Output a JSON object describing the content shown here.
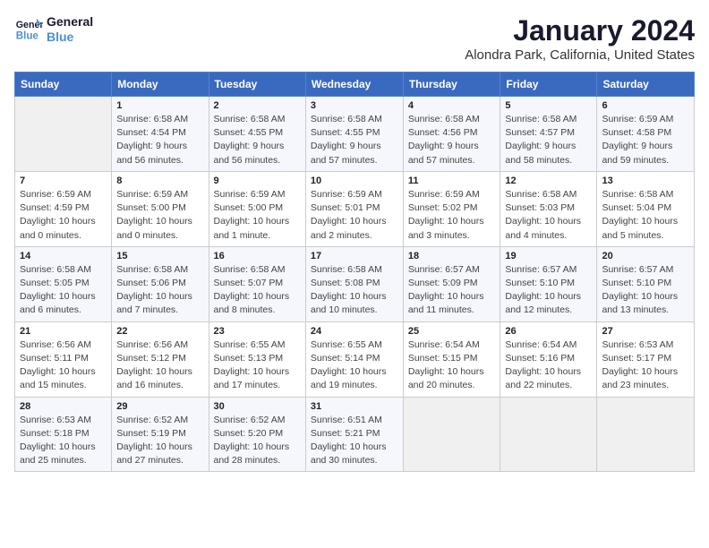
{
  "header": {
    "logo_line1": "General",
    "logo_line2": "Blue",
    "month": "January 2024",
    "location": "Alondra Park, California, United States"
  },
  "weekdays": [
    "Sunday",
    "Monday",
    "Tuesday",
    "Wednesday",
    "Thursday",
    "Friday",
    "Saturday"
  ],
  "weeks": [
    [
      {
        "day": "",
        "sunrise": "",
        "sunset": "",
        "daylight": ""
      },
      {
        "day": "1",
        "sunrise": "Sunrise: 6:58 AM",
        "sunset": "Sunset: 4:54 PM",
        "daylight": "Daylight: 9 hours and 56 minutes."
      },
      {
        "day": "2",
        "sunrise": "Sunrise: 6:58 AM",
        "sunset": "Sunset: 4:55 PM",
        "daylight": "Daylight: 9 hours and 56 minutes."
      },
      {
        "day": "3",
        "sunrise": "Sunrise: 6:58 AM",
        "sunset": "Sunset: 4:55 PM",
        "daylight": "Daylight: 9 hours and 57 minutes."
      },
      {
        "day": "4",
        "sunrise": "Sunrise: 6:58 AM",
        "sunset": "Sunset: 4:56 PM",
        "daylight": "Daylight: 9 hours and 57 minutes."
      },
      {
        "day": "5",
        "sunrise": "Sunrise: 6:58 AM",
        "sunset": "Sunset: 4:57 PM",
        "daylight": "Daylight: 9 hours and 58 minutes."
      },
      {
        "day": "6",
        "sunrise": "Sunrise: 6:59 AM",
        "sunset": "Sunset: 4:58 PM",
        "daylight": "Daylight: 9 hours and 59 minutes."
      }
    ],
    [
      {
        "day": "7",
        "sunrise": "Sunrise: 6:59 AM",
        "sunset": "Sunset: 4:59 PM",
        "daylight": "Daylight: 10 hours and 0 minutes."
      },
      {
        "day": "8",
        "sunrise": "Sunrise: 6:59 AM",
        "sunset": "Sunset: 5:00 PM",
        "daylight": "Daylight: 10 hours and 0 minutes."
      },
      {
        "day": "9",
        "sunrise": "Sunrise: 6:59 AM",
        "sunset": "Sunset: 5:00 PM",
        "daylight": "Daylight: 10 hours and 1 minute."
      },
      {
        "day": "10",
        "sunrise": "Sunrise: 6:59 AM",
        "sunset": "Sunset: 5:01 PM",
        "daylight": "Daylight: 10 hours and 2 minutes."
      },
      {
        "day": "11",
        "sunrise": "Sunrise: 6:59 AM",
        "sunset": "Sunset: 5:02 PM",
        "daylight": "Daylight: 10 hours and 3 minutes."
      },
      {
        "day": "12",
        "sunrise": "Sunrise: 6:58 AM",
        "sunset": "Sunset: 5:03 PM",
        "daylight": "Daylight: 10 hours and 4 minutes."
      },
      {
        "day": "13",
        "sunrise": "Sunrise: 6:58 AM",
        "sunset": "Sunset: 5:04 PM",
        "daylight": "Daylight: 10 hours and 5 minutes."
      }
    ],
    [
      {
        "day": "14",
        "sunrise": "Sunrise: 6:58 AM",
        "sunset": "Sunset: 5:05 PM",
        "daylight": "Daylight: 10 hours and 6 minutes."
      },
      {
        "day": "15",
        "sunrise": "Sunrise: 6:58 AM",
        "sunset": "Sunset: 5:06 PM",
        "daylight": "Daylight: 10 hours and 7 minutes."
      },
      {
        "day": "16",
        "sunrise": "Sunrise: 6:58 AM",
        "sunset": "Sunset: 5:07 PM",
        "daylight": "Daylight: 10 hours and 8 minutes."
      },
      {
        "day": "17",
        "sunrise": "Sunrise: 6:58 AM",
        "sunset": "Sunset: 5:08 PM",
        "daylight": "Daylight: 10 hours and 10 minutes."
      },
      {
        "day": "18",
        "sunrise": "Sunrise: 6:57 AM",
        "sunset": "Sunset: 5:09 PM",
        "daylight": "Daylight: 10 hours and 11 minutes."
      },
      {
        "day": "19",
        "sunrise": "Sunrise: 6:57 AM",
        "sunset": "Sunset: 5:10 PM",
        "daylight": "Daylight: 10 hours and 12 minutes."
      },
      {
        "day": "20",
        "sunrise": "Sunrise: 6:57 AM",
        "sunset": "Sunset: 5:10 PM",
        "daylight": "Daylight: 10 hours and 13 minutes."
      }
    ],
    [
      {
        "day": "21",
        "sunrise": "Sunrise: 6:56 AM",
        "sunset": "Sunset: 5:11 PM",
        "daylight": "Daylight: 10 hours and 15 minutes."
      },
      {
        "day": "22",
        "sunrise": "Sunrise: 6:56 AM",
        "sunset": "Sunset: 5:12 PM",
        "daylight": "Daylight: 10 hours and 16 minutes."
      },
      {
        "day": "23",
        "sunrise": "Sunrise: 6:55 AM",
        "sunset": "Sunset: 5:13 PM",
        "daylight": "Daylight: 10 hours and 17 minutes."
      },
      {
        "day": "24",
        "sunrise": "Sunrise: 6:55 AM",
        "sunset": "Sunset: 5:14 PM",
        "daylight": "Daylight: 10 hours and 19 minutes."
      },
      {
        "day": "25",
        "sunrise": "Sunrise: 6:54 AM",
        "sunset": "Sunset: 5:15 PM",
        "daylight": "Daylight: 10 hours and 20 minutes."
      },
      {
        "day": "26",
        "sunrise": "Sunrise: 6:54 AM",
        "sunset": "Sunset: 5:16 PM",
        "daylight": "Daylight: 10 hours and 22 minutes."
      },
      {
        "day": "27",
        "sunrise": "Sunrise: 6:53 AM",
        "sunset": "Sunset: 5:17 PM",
        "daylight": "Daylight: 10 hours and 23 minutes."
      }
    ],
    [
      {
        "day": "28",
        "sunrise": "Sunrise: 6:53 AM",
        "sunset": "Sunset: 5:18 PM",
        "daylight": "Daylight: 10 hours and 25 minutes."
      },
      {
        "day": "29",
        "sunrise": "Sunrise: 6:52 AM",
        "sunset": "Sunset: 5:19 PM",
        "daylight": "Daylight: 10 hours and 27 minutes."
      },
      {
        "day": "30",
        "sunrise": "Sunrise: 6:52 AM",
        "sunset": "Sunset: 5:20 PM",
        "daylight": "Daylight: 10 hours and 28 minutes."
      },
      {
        "day": "31",
        "sunrise": "Sunrise: 6:51 AM",
        "sunset": "Sunset: 5:21 PM",
        "daylight": "Daylight: 10 hours and 30 minutes."
      },
      {
        "day": "",
        "sunrise": "",
        "sunset": "",
        "daylight": ""
      },
      {
        "day": "",
        "sunrise": "",
        "sunset": "",
        "daylight": ""
      },
      {
        "day": "",
        "sunrise": "",
        "sunset": "",
        "daylight": ""
      }
    ]
  ]
}
